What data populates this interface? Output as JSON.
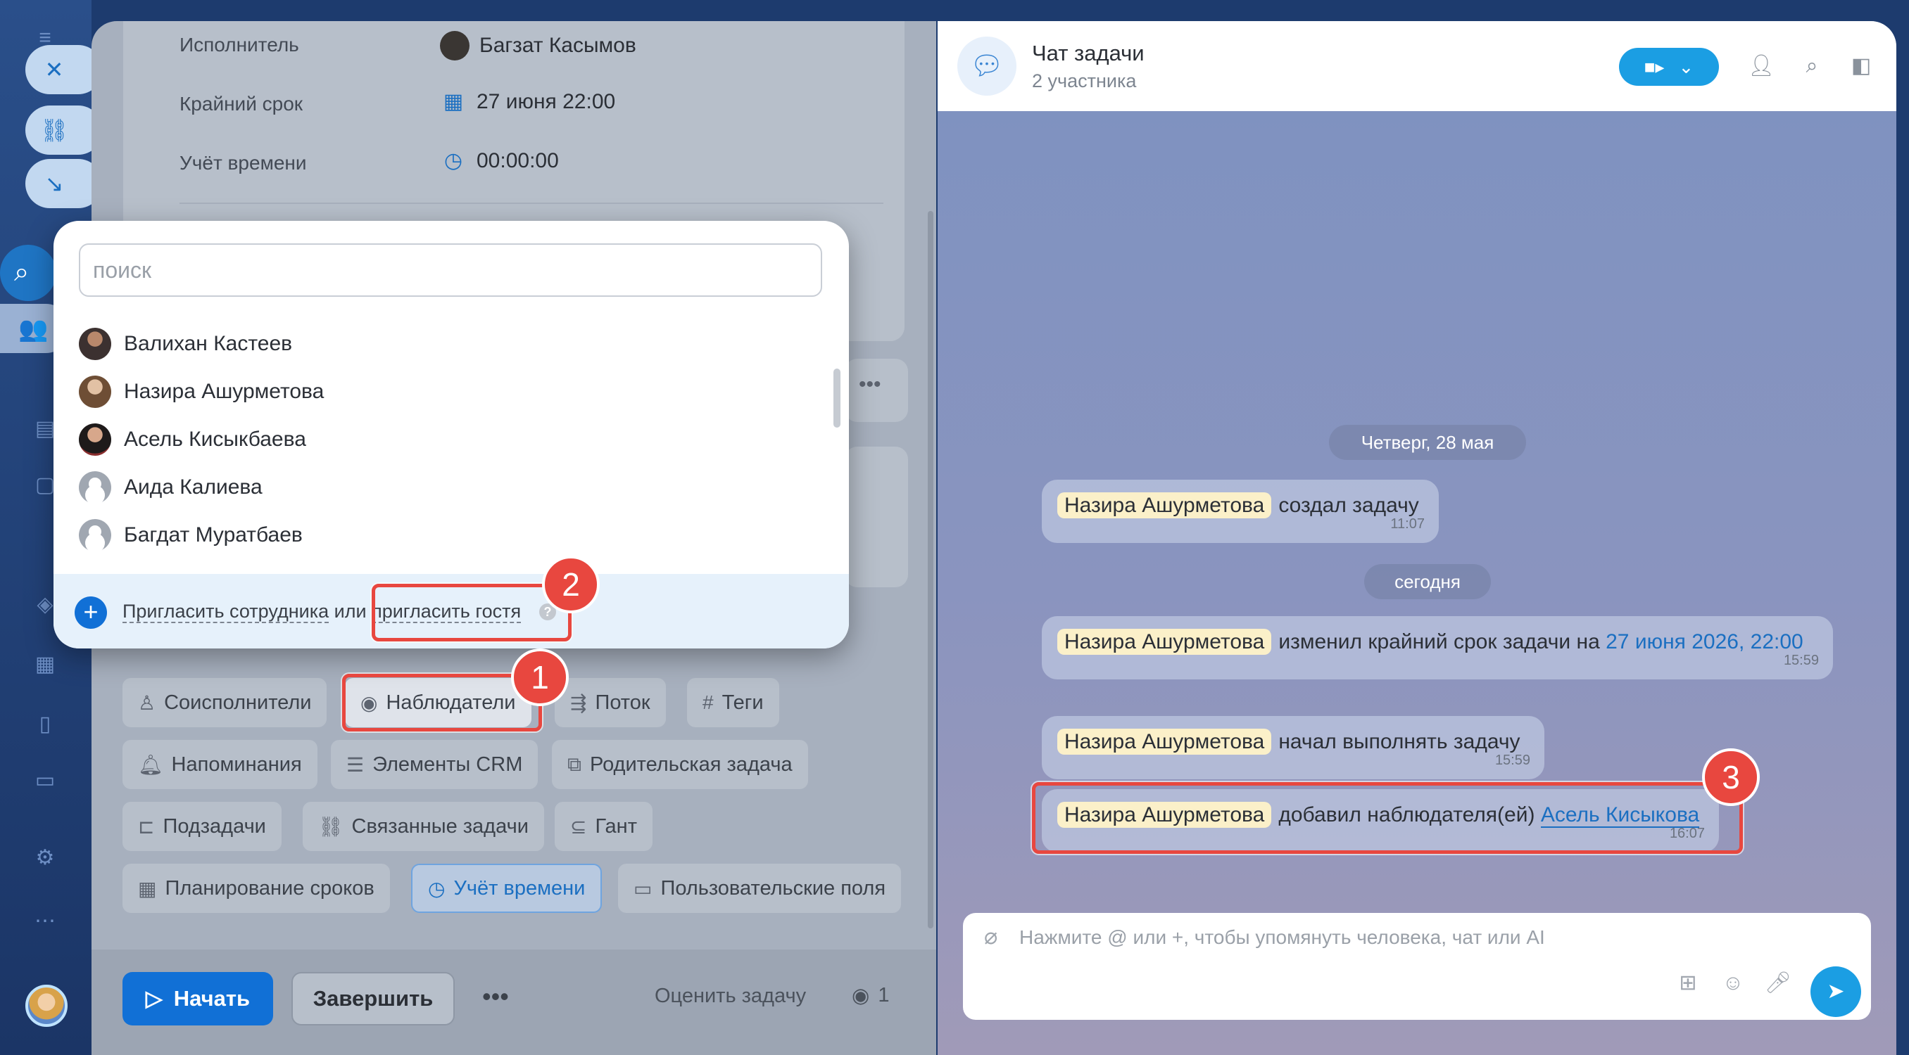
{
  "task": {
    "fields": [
      {
        "label": "Исполнитель",
        "value": "Багзат Касымов"
      },
      {
        "label": "Крайний срок",
        "value": "27 июня 22:00"
      },
      {
        "label": "Учёт времени",
        "value": "00:00:00"
      }
    ],
    "chips": [
      {
        "label": "Соисполнители",
        "icon": "user-icon"
      },
      {
        "label": "Наблюдатели",
        "icon": "eye-icon"
      },
      {
        "label": "Поток",
        "icon": "flow-icon"
      },
      {
        "label": "Теги",
        "icon": "hash-icon"
      },
      {
        "label": "Напоминания",
        "icon": "bell-icon"
      },
      {
        "label": "Элементы CRM",
        "icon": "crm-icon"
      },
      {
        "label": "Родительская задача",
        "icon": "parent-task-icon"
      },
      {
        "label": "Подзадачи",
        "icon": "subtasks-icon"
      },
      {
        "label": "Связанные задачи",
        "icon": "link-icon"
      },
      {
        "label": "Гант",
        "icon": "gantt-icon"
      },
      {
        "label": "Планирование сроков",
        "icon": "calendar-icon"
      },
      {
        "label": "Учёт времени",
        "icon": "stopwatch-icon"
      },
      {
        "label": "Пользовательские поля",
        "icon": "form-icon"
      }
    ],
    "actions": {
      "start": "Начать",
      "finish": "Завершить",
      "rate": "Оценить задачу",
      "watchers_count": "1"
    }
  },
  "popup": {
    "search_placeholder": "поиск",
    "people": [
      {
        "name": "Валихан Кастеев",
        "avatar": "photo"
      },
      {
        "name": "Назира Ашурметова",
        "avatar": "photo"
      },
      {
        "name": "Асель Кисыкбаева",
        "avatar": "photo"
      },
      {
        "name": "Аида Калиева",
        "avatar": "placeholder"
      },
      {
        "name": "Багдат Муратбаев",
        "avatar": "placeholder"
      }
    ],
    "invite": {
      "part1": "Пригласить сотрудника",
      "part2": "или",
      "part3": "пригласить гостя",
      "help": "?"
    }
  },
  "annotations": [
    "1",
    "2",
    "3"
  ],
  "chat": {
    "title": "Чат задачи",
    "subtitle": "2 участника",
    "date1": "Четверг, 28 мая",
    "date2": "сегодня",
    "messages": [
      {
        "author": "Назира Ашурметова",
        "text": "создал задачу",
        "time": "11:07"
      },
      {
        "author": "Назира Ашурметова",
        "text": "изменил крайний срок задачи на",
        "link": "27 июня 2026, 22:00",
        "time": "15:59"
      },
      {
        "author": "Назира Ашурметова",
        "text": "начал выполнять задачу",
        "time": "15:59"
      },
      {
        "author": "Назира Ашурметова",
        "text": "добавил наблюдателя(ей)",
        "link": "Асель Кисыкова",
        "time": "16:07"
      }
    ],
    "composer_placeholder": "Нажмите @ или +, чтобы упомянуть человека, чат или AI"
  },
  "colors": {
    "accent": "#1170d6",
    "annotation": "#e8473f",
    "chat_accent": "#1b9ee3",
    "mention_bg": "#fbf0c9"
  }
}
